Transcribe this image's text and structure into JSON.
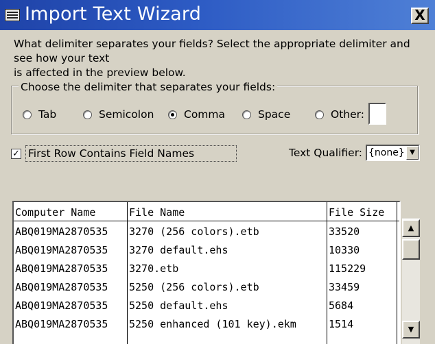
{
  "window": {
    "title": "Import Text Wizard",
    "close_glyph": "X"
  },
  "description": "What delimiter separates your fields? Select the appropriate delimiter and see how your text\nis affected in the preview below.",
  "delimiter_group": {
    "label": "Choose the delimiter that separates your fields:",
    "options": [
      {
        "label": "Tab",
        "selected": false
      },
      {
        "label": "Semicolon",
        "selected": false
      },
      {
        "label": "Comma",
        "selected": true
      },
      {
        "label": "Space",
        "selected": false
      },
      {
        "label": "Other:",
        "selected": false
      }
    ],
    "other_value": ""
  },
  "first_row_field_names": {
    "label": "First Row Contains Field Names",
    "checked": true
  },
  "text_qualifier": {
    "label": "Text Qualifier:",
    "value": "{none}"
  },
  "preview": {
    "columns": [
      "Computer Name",
      "File Name",
      "File Size"
    ],
    "rows": [
      [
        "ABQ019MA2870535",
        "3270 (256 colors).etb",
        "33520"
      ],
      [
        "ABQ019MA2870535",
        "3270 default.ehs",
        "10330"
      ],
      [
        "ABQ019MA2870535",
        "3270.etb",
        "115229"
      ],
      [
        "ABQ019MA2870535",
        "5250 (256 colors).etb",
        "33459"
      ],
      [
        "ABQ019MA2870535",
        "5250 default.ehs",
        "5684"
      ],
      [
        "ABQ019MA2870535",
        "5250 enhanced (101 key).ekm",
        "1514"
      ]
    ]
  },
  "scrollbar": {
    "up_icon": "scroll-up-arrow",
    "down_icon": "scroll-down-arrow"
  }
}
